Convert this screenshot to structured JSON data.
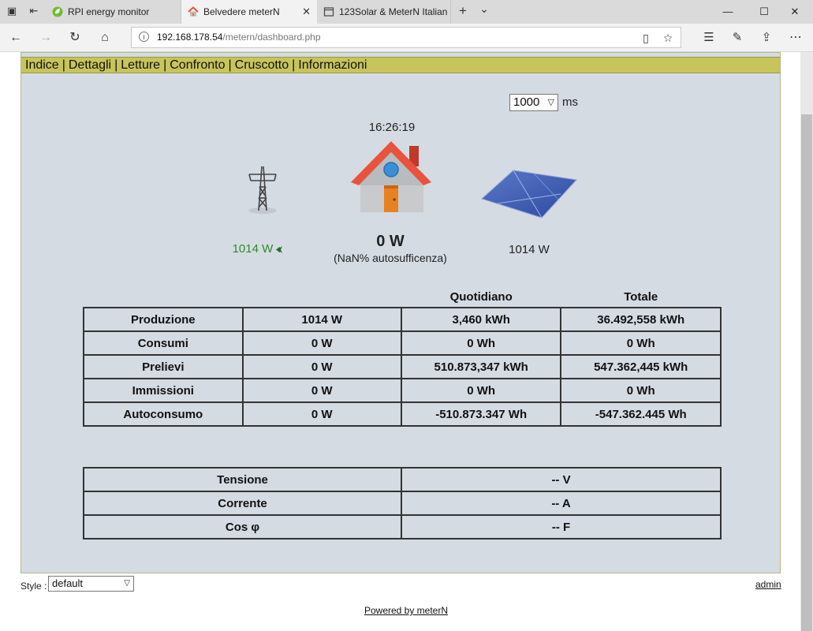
{
  "browser": {
    "tabs": [
      {
        "label": "RPI energy monitor",
        "active": false
      },
      {
        "label": "Belvedere meterN",
        "active": true
      },
      {
        "label": "123Solar & MeterN Italian f",
        "active": false
      }
    ],
    "new_tab_symbol": "+",
    "tab_list_symbol": "⌄",
    "window_controls": {
      "minimize": "—",
      "maximize": "☐",
      "close": "✕"
    },
    "url_host": "192.168.178.54",
    "url_path": "/metern/dashboard.php"
  },
  "menu": {
    "items": [
      "Indice",
      "Dettagli",
      "Letture",
      "Confronto",
      "Cruscotto",
      "Informazioni"
    ],
    "separator": "|"
  },
  "refresh": {
    "value": "1000",
    "unit": "ms"
  },
  "clock": "16:26:19",
  "flow": {
    "grid": "1014 W",
    "house": "0 W",
    "house_sub": "(NaN% autosufficenza)",
    "solar": "1014 W"
  },
  "energy_table": {
    "headers": [
      "",
      "",
      "Quotidiano",
      "Totale"
    ],
    "rows": [
      [
        "Produzione",
        "1014 W",
        "3,460 kWh",
        "36.492,558 kWh"
      ],
      [
        "Consumi",
        "0 W",
        "0 Wh",
        "0 Wh"
      ],
      [
        "Prelievi",
        "0 W",
        "510.873,347 kWh",
        "547.362,445 kWh"
      ],
      [
        "Immissioni",
        "0 W",
        "0 Wh",
        "0 Wh"
      ],
      [
        "Autoconsumo",
        "0 W",
        "-510.873.347 Wh",
        "-547.362.445 Wh"
      ]
    ]
  },
  "electrical_table": {
    "rows": [
      [
        "Tensione",
        "-- V"
      ],
      [
        "Corrente",
        "-- A"
      ],
      [
        "Cos φ",
        "-- F"
      ]
    ]
  },
  "footer": {
    "style_label": "Style :",
    "style_value": "default",
    "admin": "admin",
    "powered": "Powered by meterN"
  },
  "colors": {
    "menu_bg": "#c8c45c",
    "panel_bg": "#d5dbe3",
    "grid_value": "#2e8b2e",
    "house_roof": "#e8533c"
  }
}
